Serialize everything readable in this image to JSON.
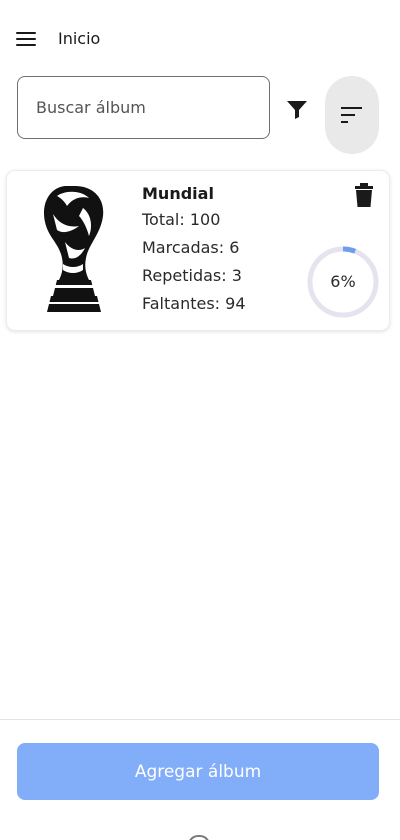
{
  "header": {
    "title": "Inicio"
  },
  "search": {
    "placeholder": "Buscar álbum"
  },
  "album": {
    "title": "Mundial",
    "total": "Total: 100",
    "marcadas": "Marcadas: 6",
    "repetidas": "Repetidas: 3",
    "faltantes": "Faltantes: 94",
    "progress_label": "6%",
    "progress_fraction": 0.06
  },
  "footer": {
    "add_label": "Agregar álbum"
  },
  "colors": {
    "accent": "#82adf8",
    "progress_track": "#e6e3ef",
    "progress_fill": "#6f9cf0"
  }
}
